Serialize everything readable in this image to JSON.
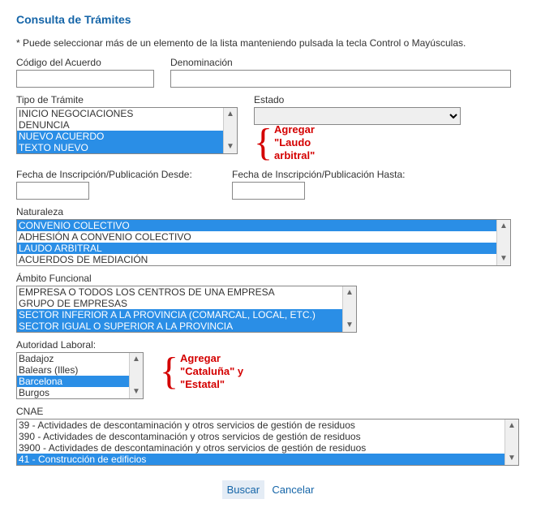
{
  "title": "Consulta de Trámites",
  "note": "* Puede seleccionar más de un elemento de la lista manteniendo pulsada la tecla Control o Mayúsculas.",
  "fields": {
    "codigo_label": "Código del Acuerdo",
    "denominacion_label": "Denominación",
    "tipo_tramite_label": "Tipo de Trámite",
    "estado_label": "Estado",
    "fecha_desde_label": "Fecha de Inscripción/Publicación Desde:",
    "fecha_hasta_label": "Fecha de Inscripción/Publicación Hasta:",
    "naturaleza_label": "Naturaleza",
    "ambito_label": "Ámbito Funcional",
    "autoridad_label": "Autoridad Laboral:",
    "cnae_label": "CNAE"
  },
  "tipo_tramite": {
    "options": [
      "INICIO NEGOCIACIONES",
      "DENUNCIA",
      "NUEVO ACUERDO",
      "TEXTO NUEVO"
    ],
    "selected": [
      2,
      3
    ]
  },
  "naturaleza": {
    "options": [
      "CONVENIO COLECTIVO",
      "ADHESIÓN A CONVENIO COLECTIVO",
      "LAUDO ARBITRAL",
      "ACUERDOS DE MEDIACIÓN"
    ],
    "selected": [
      0,
      2
    ]
  },
  "ambito": {
    "options": [
      "EMPRESA O TODOS LOS CENTROS DE UNA EMPRESA",
      "GRUPO DE EMPRESAS",
      "SECTOR INFERIOR A LA PROVINCIA (COMARCAL, LOCAL, ETC.)",
      "SECTOR IGUAL O SUPERIOR A LA PROVINCIA"
    ],
    "selected": [
      2,
      3
    ]
  },
  "autoridad": {
    "options": [
      "Badajoz",
      "Balears (Illes)",
      "Barcelona",
      "Burgos"
    ],
    "selected": [
      2
    ]
  },
  "cnae": {
    "options": [
      "39 - Actividades de descontaminación y otros servicios de gestión de residuos",
      "390 - Actividades de descontaminación y otros servicios de gestión de residuos",
      "3900 - Actividades de descontaminación y otros servicios de gestión de residuos",
      "41 - Construcción de edificios"
    ],
    "selected": [
      3
    ]
  },
  "annotations": {
    "laudo": "Agregar \"Laudo arbitral\"",
    "cataluna": "Agregar \"Cataluña\" y \"Estatal\""
  },
  "buttons": {
    "buscar": "Buscar",
    "cancelar": "Cancelar"
  }
}
